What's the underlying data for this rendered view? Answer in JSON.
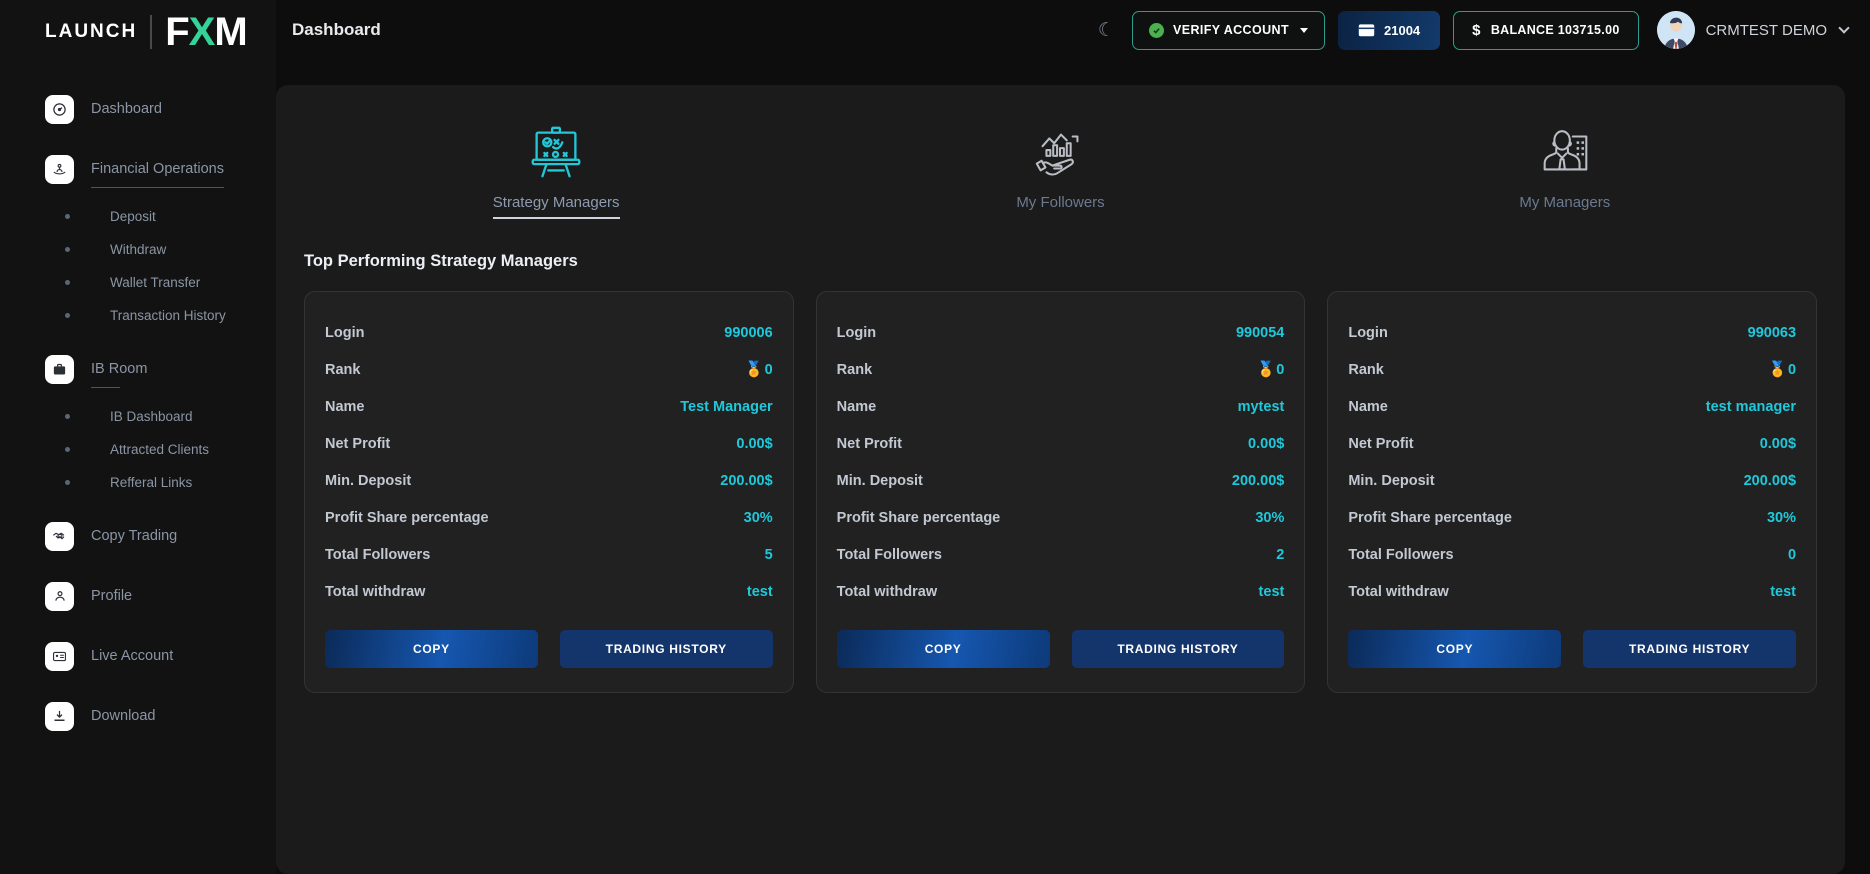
{
  "brand": {
    "launch": "LAUNCH",
    "f": "F",
    "x": "X",
    "m": "M",
    "accent": "#34d399"
  },
  "sidebar": {
    "items": [
      {
        "label": "Dashboard",
        "icon": "dashboard-icon"
      },
      {
        "label": "Financial Operations",
        "icon": "financial-operations-icon"
      },
      {
        "label": "IB Room",
        "icon": "briefcase-icon"
      },
      {
        "label": "Copy Trading",
        "icon": "handshake-icon"
      },
      {
        "label": "Profile",
        "icon": "user-icon"
      },
      {
        "label": "Live Account",
        "icon": "id-card-icon"
      },
      {
        "label": "Download",
        "icon": "download-icon"
      }
    ],
    "financial_sub": [
      {
        "label": "Deposit"
      },
      {
        "label": "Withdraw"
      },
      {
        "label": "Wallet Transfer"
      },
      {
        "label": "Transaction History"
      }
    ],
    "ib_sub": [
      {
        "label": "IB Dashboard"
      },
      {
        "label": "Attracted Clients"
      },
      {
        "label": "Refferal Links"
      }
    ]
  },
  "header": {
    "title": "Dashboard",
    "theme_toggle_icon": "moon-icon",
    "verify_label": "VERIFY ACCOUNT",
    "account_number": "21004",
    "balance_label": "BALANCE 103715.00",
    "currency_symbol": "$",
    "user_name": "CRMTEST DEMO",
    "accent": "#2a9d8f"
  },
  "main": {
    "tabs": [
      {
        "label": "Strategy Managers",
        "icon": "strategy-board-icon",
        "active": true
      },
      {
        "label": "My Followers",
        "icon": "hand-chart-icon",
        "active": false
      },
      {
        "label": "My Managers",
        "icon": "manager-building-icon",
        "active": false
      }
    ],
    "section_title": "Top Performing Strategy Managers",
    "row_labels": [
      "Login",
      "Rank",
      "Name",
      "Net Profit",
      "Min. Deposit",
      "Profit Share percentage",
      "Total Followers",
      "Total withdraw"
    ],
    "buttons": {
      "copy": "COPY",
      "history": "TRADING HISTORY"
    },
    "medal_icon": "medal-icon",
    "value_color": "#1fc8db",
    "cards": [
      {
        "login": "990006",
        "rank": "0",
        "name": "Test Manager",
        "net_profit": "0.00$",
        "min_deposit": "200.00$",
        "profit_share": "30%",
        "total_followers": "5",
        "total_withdraw": "test"
      },
      {
        "login": "990054",
        "rank": "0",
        "name": "mytest",
        "net_profit": "0.00$",
        "min_deposit": "200.00$",
        "profit_share": "30%",
        "total_followers": "2",
        "total_withdraw": "test"
      },
      {
        "login": "990063",
        "rank": "0",
        "name": "test manager",
        "net_profit": "0.00$",
        "min_deposit": "200.00$",
        "profit_share": "30%",
        "total_followers": "0",
        "total_withdraw": "test"
      }
    ]
  }
}
